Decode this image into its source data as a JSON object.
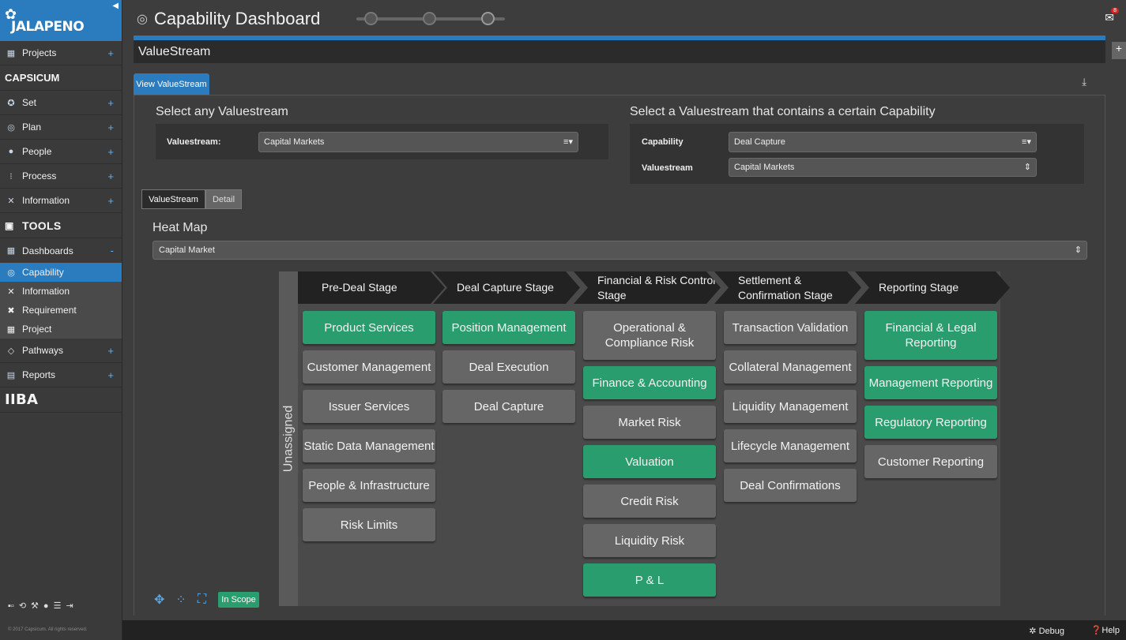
{
  "sidebar": {
    "brand": "JALAPENO",
    "items_top": [
      {
        "label": "Projects",
        "icon": "map-icon"
      }
    ],
    "capsicum": "CAPSICUM",
    "items_cap": [
      {
        "label": "Set",
        "icon": "medal-icon"
      },
      {
        "label": "Plan",
        "icon": "target-icon"
      },
      {
        "label": "People",
        "icon": "person-icon"
      },
      {
        "label": "Process",
        "icon": "flow-icon"
      },
      {
        "label": "Information",
        "icon": "tools-icon"
      }
    ],
    "tools": "TOOLS",
    "dashboards": "Dashboards",
    "dashboards_toggle": "-",
    "subitems": [
      {
        "label": "Capability",
        "active": true
      },
      {
        "label": "Information",
        "active": false
      },
      {
        "label": "Requirement",
        "active": false
      },
      {
        "label": "Project",
        "active": false
      }
    ],
    "items_bottom": [
      {
        "label": "Pathways",
        "icon": "pathways-icon"
      },
      {
        "label": "Reports",
        "icon": "briefcase-icon"
      }
    ],
    "iiba": "IIBA",
    "copyright": "© 2017 Capsicum. All rights reserved."
  },
  "header": {
    "title": "Capability Dashboard",
    "mail_badge": "8",
    "valuestream_bar": "ValueStream",
    "tab": "View ValueStream"
  },
  "select_any": {
    "title": "Select any Valuestream",
    "label": "Valuestream:",
    "value": "Capital Markets"
  },
  "select_cap": {
    "title": "Select a Valuestream that contains a certain Capability",
    "capability_label": "Capability",
    "capability_value": "Deal Capture",
    "valuestream_label": "Valuestream",
    "valuestream_value": "Capital Markets"
  },
  "toggle": {
    "valuestream": "ValueStream",
    "detail": "Detail"
  },
  "heatmap": {
    "title": "Heat Map",
    "select_value": "Capital Market",
    "unassigned": "Unassigned",
    "in_scope": "In Scope",
    "stages": [
      {
        "label": "Pre-Deal Stage",
        "caps": [
          {
            "label": "Product Services",
            "in": true
          },
          {
            "label": "Customer Management",
            "in": false
          },
          {
            "label": "Issuer Services",
            "in": false
          },
          {
            "label": "Static Data Management",
            "in": false
          },
          {
            "label": "People & Infrastructure",
            "in": false
          },
          {
            "label": "Risk Limits",
            "in": false
          }
        ]
      },
      {
        "label": "Deal Capture Stage",
        "caps": [
          {
            "label": "Position Management",
            "in": true
          },
          {
            "label": "Deal Execution",
            "in": false
          },
          {
            "label": "Deal Capture",
            "in": false
          }
        ]
      },
      {
        "label": "Financial & Risk Control Stage",
        "caps": [
          {
            "label": "Operational & Compliance Risk",
            "in": false
          },
          {
            "label": "Finance & Accounting",
            "in": true
          },
          {
            "label": "Market Risk",
            "in": false
          },
          {
            "label": "Valuation",
            "in": true
          },
          {
            "label": "Credit Risk",
            "in": false
          },
          {
            "label": "Liquidity Risk",
            "in": false
          },
          {
            "label": "P & L",
            "in": true
          }
        ]
      },
      {
        "label": "Settlement & Confirmation Stage",
        "caps": [
          {
            "label": "Transaction Validation",
            "in": false
          },
          {
            "label": "Collateral Management",
            "in": false
          },
          {
            "label": "Liquidity Management",
            "in": false
          },
          {
            "label": "Lifecycle Management",
            "in": false
          },
          {
            "label": "Deal Confirmations",
            "in": false
          }
        ]
      },
      {
        "label": "Reporting Stage",
        "caps": [
          {
            "label": "Financial & Legal Reporting",
            "in": true
          },
          {
            "label": "Management Reporting",
            "in": true
          },
          {
            "label": "Regulatory Reporting",
            "in": true
          },
          {
            "label": "Customer Reporting",
            "in": false
          }
        ]
      }
    ]
  },
  "footer": {
    "debug": "Debug",
    "help": "Help"
  },
  "colors": {
    "accent": "#2a7cbf",
    "in_scope": "#2a9d6e",
    "out_scope": "#666666"
  }
}
